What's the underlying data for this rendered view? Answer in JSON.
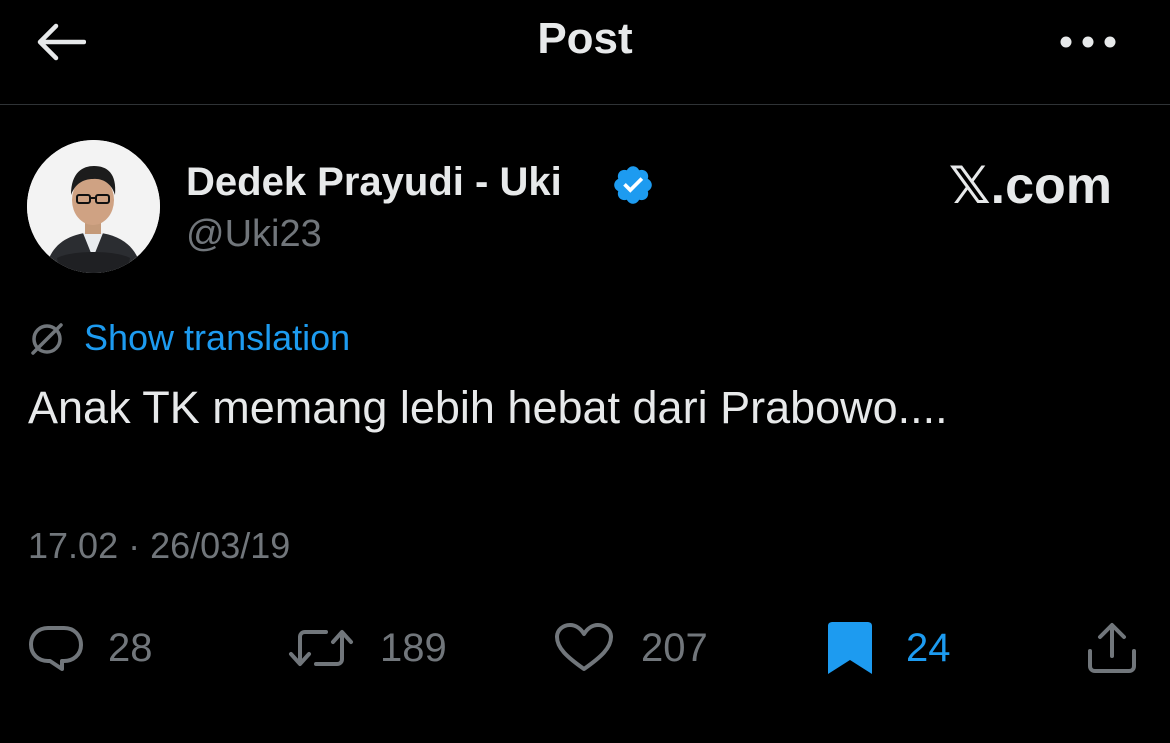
{
  "header": {
    "title": "Post"
  },
  "author": {
    "name": "Dedek Prayudi - Uki",
    "handle": "@Uki23",
    "verified": true
  },
  "brand": "𝕏.com",
  "translate": {
    "label": "Show translation"
  },
  "tweet": {
    "text": "Anak TK memang lebih hebat dari Prabowo...."
  },
  "timestamp": {
    "time": "17.02",
    "separator": "·",
    "date": "26/03/19"
  },
  "actions": {
    "replies": "28",
    "reposts": "189",
    "likes": "207",
    "bookmarks": "24"
  },
  "icons": {
    "back": "arrow-left-icon",
    "more": "more-horizontal-icon",
    "verified": "verified-badge-icon",
    "translate": "globe-slash-icon",
    "reply": "speech-bubble-icon",
    "repost": "repost-arrows-icon",
    "like": "heart-outline-icon",
    "bookmark": "bookmark-filled-icon",
    "share": "share-upload-icon"
  },
  "colors": {
    "background": "#000000",
    "text": "#e7e9ea",
    "muted": "#71767b",
    "accent": "#1d9bf0",
    "divider": "#2f3336"
  }
}
